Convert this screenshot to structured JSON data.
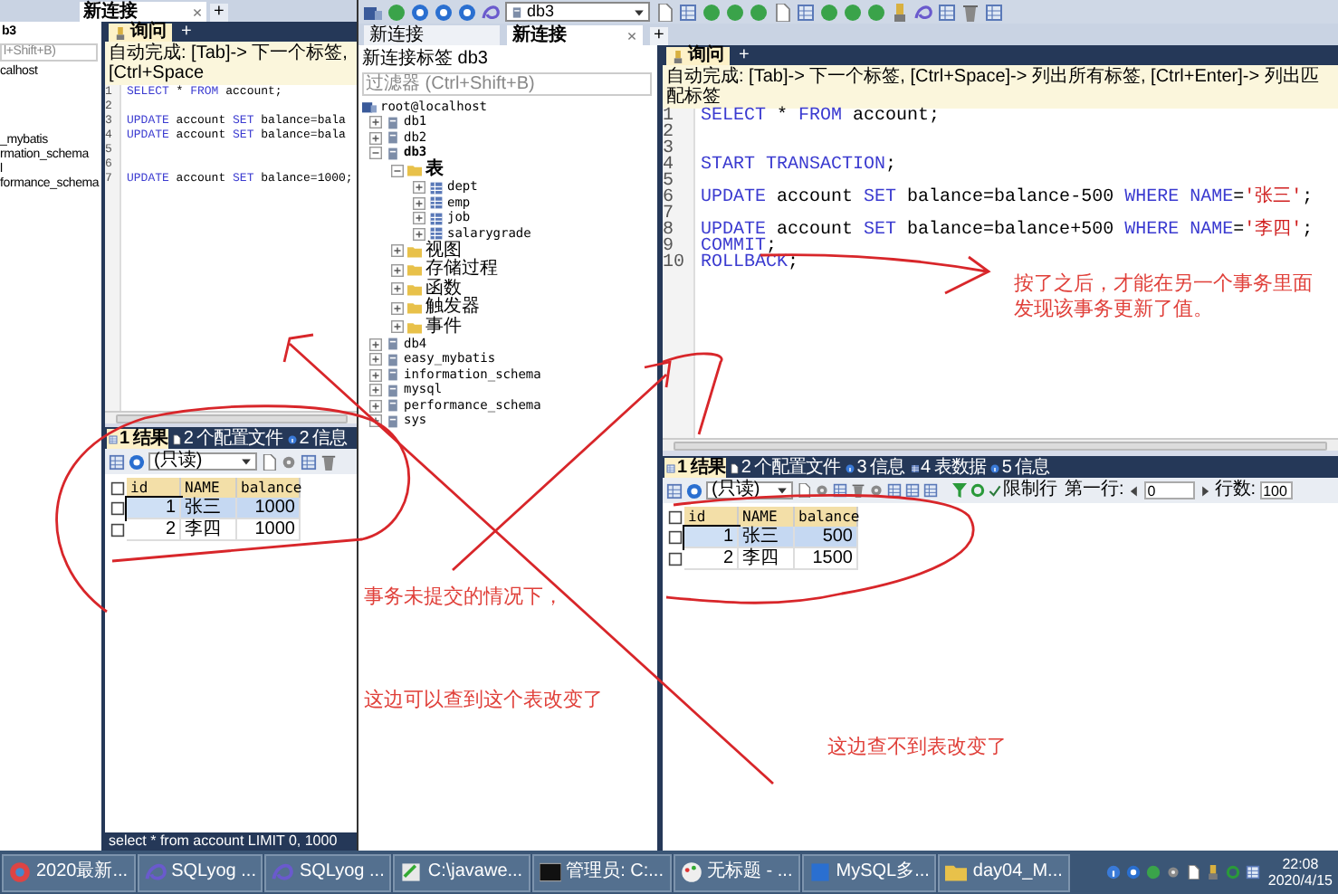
{
  "left_window": {
    "tab": {
      "label": "新连接",
      "selected": true
    },
    "new_tab": "+",
    "explorer": {
      "title": "b3",
      "filter": "l+Shift+B)",
      "items": [
        "calhost",
        "_mybatis",
        "rmation_schema",
        "l",
        "formance_schema"
      ]
    },
    "query": {
      "tab": "询问",
      "new_tab": "+",
      "autocomplete": "自动完成: [Tab]-> 下一个标签, [Ctrl+Space",
      "lines": [
        {
          "number": "1",
          "tokens": [
            {
              "kind": "keyword",
              "text": "SELECT"
            },
            {
              "kind": "plain",
              "text": " * "
            },
            {
              "kind": "keyword",
              "text": "FROM"
            },
            {
              "kind": "plain",
              "text": " account;"
            }
          ]
        },
        {
          "number": "2"
        },
        {
          "number": "3",
          "tokens": [
            {
              "kind": "keyword",
              "text": "UPDATE"
            },
            {
              "kind": "plain",
              "text": " account "
            },
            {
              "kind": "keyword",
              "text": "SET"
            },
            {
              "kind": "plain",
              "text": " balance=bala"
            }
          ]
        },
        {
          "number": "4",
          "tokens": [
            {
              "kind": "keyword",
              "text": "UPDATE"
            },
            {
              "kind": "plain",
              "text": " account "
            },
            {
              "kind": "keyword",
              "text": "SET"
            },
            {
              "kind": "plain",
              "text": " balance=bala"
            }
          ]
        },
        {
          "number": "5"
        },
        {
          "number": "6"
        },
        {
          "number": "7",
          "tokens": [
            {
              "kind": "keyword",
              "text": "UPDATE"
            },
            {
              "kind": "plain",
              "text": " account "
            },
            {
              "kind": "keyword",
              "text": "SET"
            },
            {
              "kind": "plain",
              "text": " balance=1000;"
            }
          ]
        }
      ]
    },
    "result_tabs": [
      {
        "number": "1",
        "label": "结果",
        "selected": true
      },
      {
        "number": "2",
        "label": "个配置文件",
        "selected": false
      },
      {
        "number": "2",
        "label": "信息",
        "selected": false
      }
    ],
    "mode": "(只读)",
    "table": {
      "all_checked": false,
      "columns": [
        "id",
        "NAME",
        "balance"
      ],
      "rows": [
        {
          "selected": true,
          "checked": false,
          "cells": [
            "1",
            "张三",
            "1000"
          ]
        },
        {
          "selected": false,
          "checked": false,
          "cells": [
            "2",
            "李四",
            "1000"
          ]
        }
      ]
    },
    "status_bar": "select * from account LIMIT 0, 1000"
  },
  "right_window": {
    "database": "db3",
    "tabs": [
      {
        "label": "新连接",
        "selected": false
      },
      {
        "label": "新连接",
        "selected": true
      }
    ],
    "new_tab": "+",
    "explorer": {
      "title": "新连接标签 db3",
      "filter": "过滤器 (Ctrl+Shift+B)",
      "tree": [
        {
          "label": "root@localhost",
          "kind": "server",
          "children": [
            {
              "label": "db1",
              "kind": "database",
              "expanded": false
            },
            {
              "label": "db2",
              "kind": "database",
              "expanded": false
            },
            {
              "label": "db3",
              "kind": "database",
              "expanded": true,
              "children": [
                {
                  "label": "表",
                  "kind": "folder",
                  "expanded": true,
                  "children": [
                    {
                      "label": "dept",
                      "kind": "table",
                      "expanded": false
                    },
                    {
                      "label": "emp",
                      "kind": "table",
                      "expanded": false
                    },
                    {
                      "label": "job",
                      "kind": "table",
                      "expanded": false
                    },
                    {
                      "label": "salarygrade",
                      "kind": "table",
                      "expanded": false
                    }
                  ]
                },
                {
                  "label": "视图",
                  "kind": "folder",
                  "expanded": false
                },
                {
                  "label": "存储过程",
                  "kind": "folder",
                  "expanded": false
                },
                {
                  "label": "函数",
                  "kind": "folder",
                  "expanded": false
                },
                {
                  "label": "触发器",
                  "kind": "folder",
                  "expanded": false
                },
                {
                  "label": "事件",
                  "kind": "folder",
                  "expanded": false
                }
              ]
            },
            {
              "label": "db4",
              "kind": "database",
              "expanded": false
            },
            {
              "label": "easy_mybatis",
              "kind": "database",
              "expanded": false
            },
            {
              "label": "information_schema",
              "kind": "database",
              "expanded": false
            },
            {
              "label": "mysql",
              "kind": "database",
              "expanded": false
            },
            {
              "label": "performance_schema",
              "kind": "database",
              "expanded": false
            },
            {
              "label": "sys",
              "kind": "database",
              "expanded": false
            }
          ]
        }
      ]
    },
    "query": {
      "tab": "询问",
      "new_tab": "+",
      "autocomplete": "自动完成: [Tab]-> 下一个标签, [Ctrl+Space]-> 列出所有标签, [Ctrl+Enter]-> 列出匹配标签",
      "lines": [
        {
          "number": "1",
          "tokens": [
            {
              "kind": "keyword",
              "text": "SELECT"
            },
            {
              "kind": "plain",
              "text": " * "
            },
            {
              "kind": "keyword",
              "text": "FROM"
            },
            {
              "kind": "plain",
              "text": " account;"
            }
          ]
        },
        {
          "number": "2"
        },
        {
          "number": "3"
        },
        {
          "number": "4",
          "tokens": [
            {
              "kind": "keyword",
              "text": "START TRANSACTION"
            },
            {
              "kind": "plain",
              "text": ";"
            }
          ]
        },
        {
          "number": "5"
        },
        {
          "number": "6",
          "tokens": [
            {
              "kind": "keyword",
              "text": "UPDATE"
            },
            {
              "kind": "plain",
              "text": " account "
            },
            {
              "kind": "keyword",
              "text": "SET"
            },
            {
              "kind": "plain",
              "text": " balance=balance-500 "
            },
            {
              "kind": "keyword",
              "text": "WHERE NAME"
            },
            {
              "kind": "plain",
              "text": "="
            },
            {
              "kind": "string",
              "text": "'张三'"
            },
            {
              "kind": "plain",
              "text": ";"
            }
          ]
        },
        {
          "number": "7"
        },
        {
          "number": "8",
          "tokens": [
            {
              "kind": "keyword",
              "text": "UPDATE"
            },
            {
              "kind": "plain",
              "text": " account "
            },
            {
              "kind": "keyword",
              "text": "SET"
            },
            {
              "kind": "plain",
              "text": " balance=balance+500 "
            },
            {
              "kind": "keyword",
              "text": "WHERE NAME"
            },
            {
              "kind": "plain",
              "text": "="
            },
            {
              "kind": "string",
              "text": "'李四'"
            },
            {
              "kind": "plain",
              "text": ";"
            }
          ]
        },
        {
          "number": "9",
          "tokens": [
            {
              "kind": "keyword",
              "text": "COMMIT"
            },
            {
              "kind": "plain",
              "text": ";"
            }
          ]
        },
        {
          "number": "10",
          "tokens": [
            {
              "kind": "keyword",
              "text": "ROLLBACK"
            },
            {
              "kind": "plain",
              "text": ";"
            }
          ]
        }
      ]
    },
    "result_tabs": [
      {
        "number": "1",
        "label": "结果",
        "selected": true
      },
      {
        "number": "2",
        "label": "个配置文件",
        "selected": false
      },
      {
        "number": "3",
        "label": "信息",
        "selected": false
      },
      {
        "number": "4",
        "label": "表数据",
        "selected": false
      },
      {
        "number": "5",
        "label": "信息",
        "selected": false
      }
    ],
    "mode": "(只读)",
    "limit_rows": {
      "label": "限制行",
      "checked": true
    },
    "first_row": {
      "label": "第一行:",
      "value": "0"
    },
    "row_count": {
      "label": "行数:",
      "value": "100"
    },
    "table": {
      "all_checked": false,
      "columns": [
        "id",
        "NAME",
        "balance"
      ],
      "rows": [
        {
          "selected": true,
          "checked": false,
          "cells": [
            "1",
            "张三",
            "500"
          ]
        },
        {
          "selected": false,
          "checked": false,
          "cells": [
            "2",
            "李四",
            "1500"
          ]
        }
      ]
    }
  },
  "annotations": [
    {
      "lines": [
        "按了之后，才能在另一个事务里面",
        "发现该事务更新了值。"
      ]
    },
    {
      "lines": [
        "事务未提交的情况下，"
      ]
    },
    {
      "lines": [
        "这边可以查到这个表改变了"
      ]
    },
    {
      "lines": [
        "这边查不到表改变了"
      ]
    }
  ],
  "taskbar": {
    "items": [
      {
        "label": "2020最新...",
        "kind": "browser"
      },
      {
        "label": "SQLyog ...",
        "kind": "sqlyog"
      },
      {
        "label": "SQLyog ...",
        "kind": "sqlyog"
      },
      {
        "label": "C:\\javawe...",
        "kind": "editor"
      },
      {
        "label": "管理员: C:...",
        "kind": "console"
      },
      {
        "label": "无标题 - ...",
        "kind": "paint"
      },
      {
        "label": "MySQL多...",
        "kind": "document"
      },
      {
        "label": "day04_M...",
        "kind": "folder"
      }
    ],
    "time": "22:08",
    "date": "2020/4/15"
  }
}
